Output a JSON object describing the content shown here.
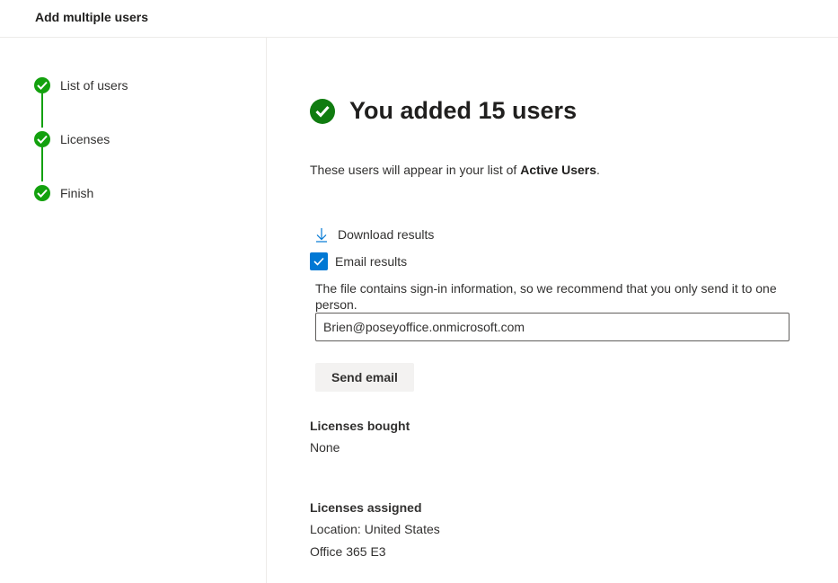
{
  "header": {
    "title": "Add multiple users"
  },
  "steps": [
    {
      "label": "List of users",
      "status": "complete"
    },
    {
      "label": "Licenses",
      "status": "complete"
    },
    {
      "label": "Finish",
      "status": "complete"
    }
  ],
  "main": {
    "title": "You added 15 users",
    "subtitle_prefix": "These users will appear in your list of ",
    "subtitle_bold": "Active Users",
    "subtitle_suffix": ".",
    "download_label": "Download results",
    "email_results_label": "Email results",
    "email_results_checked": true,
    "info_text": "The file contains sign-in information, so we recommend that you only send it to one person.",
    "email_value": "Brien@poseyoffice.onmicrosoft.com",
    "send_label": "Send email",
    "licenses_bought_heading": "Licenses bought",
    "licenses_bought_value": "None",
    "licenses_assigned_heading": "Licenses assigned",
    "licenses_assigned_location": "Location: United States",
    "licenses_assigned_product": "Office 365 E3"
  },
  "colors": {
    "step_green": "#13a10e",
    "success_green": "#107c10",
    "accent_blue": "#0078d4"
  },
  "icons": {
    "step": "checkmark-icon",
    "success": "checkmark-circle-icon",
    "download": "download-icon",
    "checkbox": "checkmark-icon"
  }
}
